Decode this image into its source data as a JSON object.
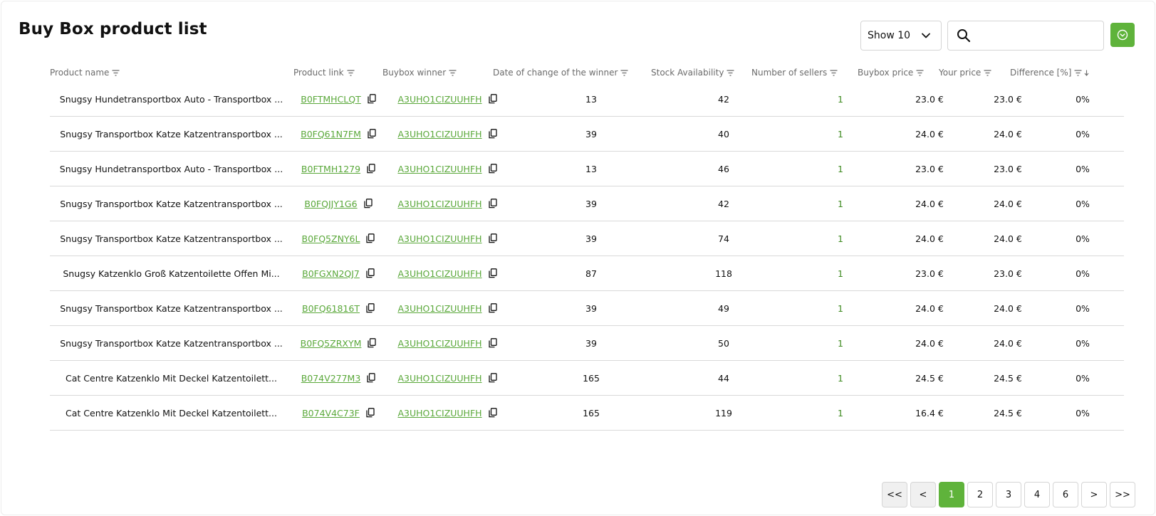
{
  "page": {
    "title": "Buy Box product list"
  },
  "controls": {
    "show_label": "Show 10",
    "search_placeholder": "",
    "accent_color": "#5fb33b"
  },
  "columns": [
    {
      "key": "name",
      "label": "Product name",
      "sort": false
    },
    {
      "key": "link",
      "label": "Product link",
      "sort": false
    },
    {
      "key": "winner",
      "label": "Buybox winner",
      "sort": false
    },
    {
      "key": "date",
      "label": "Date of change of the winner",
      "sort": false
    },
    {
      "key": "stock",
      "label": "Stock Availability",
      "sort": false
    },
    {
      "key": "sellers",
      "label": "Number of sellers",
      "sort": false
    },
    {
      "key": "buybox",
      "label": "Buybox price",
      "sort": false
    },
    {
      "key": "your",
      "label": "Your price",
      "sort": false
    },
    {
      "key": "diff",
      "label": "Difference [%]",
      "sort": true
    }
  ],
  "rows": [
    {
      "name": "Snugsy Hundetransportbox Auto - Transportbox ...",
      "link": "B0FTMHCLQT",
      "winner": "A3UHO1CIZUUHFH",
      "date": "13",
      "stock": "42",
      "sellers": "1",
      "buybox": "23.0 €",
      "your": "23.0 €",
      "diff": "0%"
    },
    {
      "name": "Snugsy Transportbox Katze Katzentransportbox ...",
      "link": "B0FQ61N7FM",
      "winner": "A3UHO1CIZUUHFH",
      "date": "39",
      "stock": "40",
      "sellers": "1",
      "buybox": "24.0 €",
      "your": "24.0 €",
      "diff": "0%"
    },
    {
      "name": "Snugsy Hundetransportbox Auto - Transportbox ...",
      "link": "B0FTMH1279",
      "winner": "A3UHO1CIZUUHFH",
      "date": "13",
      "stock": "46",
      "sellers": "1",
      "buybox": "23.0 €",
      "your": "23.0 €",
      "diff": "0%"
    },
    {
      "name": "Snugsy Transportbox Katze Katzentransportbox ...",
      "link": "B0FQJJY1G6",
      "winner": "A3UHO1CIZUUHFH",
      "date": "39",
      "stock": "42",
      "sellers": "1",
      "buybox": "24.0 €",
      "your": "24.0 €",
      "diff": "0%"
    },
    {
      "name": "Snugsy Transportbox Katze Katzentransportbox ...",
      "link": "B0FQ5ZNY6L",
      "winner": "A3UHO1CIZUUHFH",
      "date": "39",
      "stock": "74",
      "sellers": "1",
      "buybox": "24.0 €",
      "your": "24.0 €",
      "diff": "0%"
    },
    {
      "name": "Snugsy Katzenklo Groß Katzentoilette Offen Mi...",
      "link": "B0FGXN2QJ7",
      "winner": "A3UHO1CIZUUHFH",
      "date": "87",
      "stock": "118",
      "sellers": "1",
      "buybox": "23.0 €",
      "your": "23.0 €",
      "diff": "0%"
    },
    {
      "name": "Snugsy Transportbox Katze Katzentransportbox ...",
      "link": "B0FQ61816T",
      "winner": "A3UHO1CIZUUHFH",
      "date": "39",
      "stock": "49",
      "sellers": "1",
      "buybox": "24.0 €",
      "your": "24.0 €",
      "diff": "0%"
    },
    {
      "name": "Snugsy Transportbox Katze Katzentransportbox ...",
      "link": "B0FQ5ZRXYM",
      "winner": "A3UHO1CIZUUHFH",
      "date": "39",
      "stock": "50",
      "sellers": "1",
      "buybox": "24.0 €",
      "your": "24.0 €",
      "diff": "0%"
    },
    {
      "name": "Cat Centre Katzenklo Mit Deckel Katzentoilett...",
      "link": "B074V277M3",
      "winner": "A3UHO1CIZUUHFH",
      "date": "165",
      "stock": "44",
      "sellers": "1",
      "buybox": "24.5 €",
      "your": "24.5 €",
      "diff": "0%"
    },
    {
      "name": "Cat Centre Katzenklo Mit Deckel Katzentoilett...",
      "link": "B074V4C73F",
      "winner": "A3UHO1CIZUUHFH",
      "date": "165",
      "stock": "119",
      "sellers": "1",
      "buybox": "16.4 €",
      "your": "24.5 €",
      "diff": "0%"
    }
  ],
  "pagination": {
    "first": "<<",
    "prev": "<",
    "pages": [
      "1",
      "2",
      "3",
      "4",
      "6"
    ],
    "current": "1",
    "next": ">",
    "last": ">>"
  },
  "icons": {
    "filter": "filter-icon",
    "sort_desc": "sort-desc-icon",
    "copy": "copy-icon",
    "search": "search-icon",
    "chevron": "chevron-down-icon",
    "submit": "circle-chevron-down-icon"
  }
}
